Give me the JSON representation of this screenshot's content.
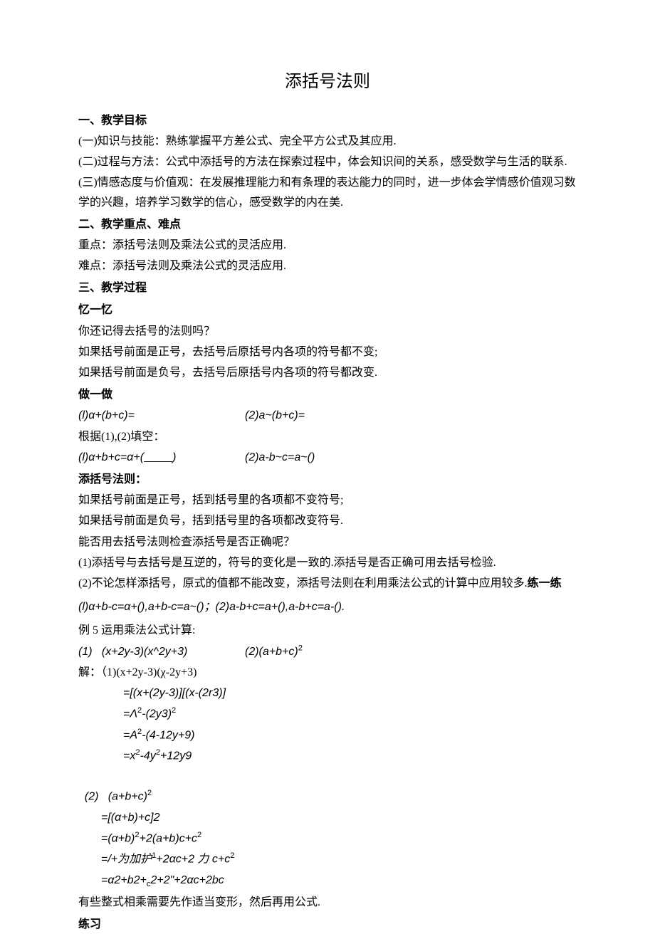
{
  "title": "添括号法则",
  "s1": {
    "heading": "一、教学目标",
    "p1": "(一)知识与技能：熟练掌握平方差公式、完全平方公式及其应用.",
    "p2": "(二)过程与方法：公式中添括号的方法在探索过程中，体会知识间的关系，感受数学与生活的联系.",
    "p3": "(三)情感态度与价值观：在发展推理能力和有条理的表达能力的同时，进一步体会学情感价值观习数学的兴趣，培养学习数学的信心，感受数学的内在美."
  },
  "s2": {
    "heading": "二、教学重点、难点",
    "p1": "重点：添括号法则及乘法公式的灵活应用.",
    "p2": "难点：添括号法则及乘法公式的灵活应用."
  },
  "s3": {
    "heading": "三、教学过程",
    "sub1": "忆一忆",
    "p1": "你还记得去括号的法则吗？",
    "p2": "如果括号前面是正号，去括号后原括号内各项的符号都不变;",
    "p3": "如果括号前面是负号，去括号后原括号内各项的符号都改变.",
    "sub2": "做一做",
    "eq1a": "(l)α+(b+c)=",
    "eq1b": "(2)a~(b+c)=",
    "p4": "根据(1),(2)填空：",
    "eq2a": "(l)α+b+c=α+(",
    "blank": "          ",
    "eq2a_end": ")",
    "eq2b": "(2)a-b~c=a~()",
    "sub3": "添括号法则：",
    "p5": "如果括号前面是正号，括到括号里的各项都不变符号;",
    "p6": "如果括号前面是负号，括到括号里的各项都改变符号.",
    "p7": "能否用去括号法则检查添括号是否正确呢？",
    "p8": "(1)添括号与去括号是互逆的，符号的变化是一致的.添括号是否正确可用去括号检验.",
    "p9_a": "(2)不论怎样添括号，原式的值都不能改变，添括号法则在利用乘法公式的计算中应用较多.",
    "p9_b": "练一练",
    "eq3": "(l)α+b-c=α+(),a+b-c=a~()；(2)a-b+c=a+(),a-b+c=a-().",
    "ex5": "例 5 运用乘法公式计算:",
    "ex5_1a": "(1)   (x+2y-3)(x^2y+3)",
    "ex5_1b": "(2)(a+b+c)",
    "sol": "解：（1)(x+2y-3)(χ-2y+3)",
    "sol_l1": "=[(x+(2y-3)][(x-(2r3)]",
    "sol_l2_a": "=Λ",
    "sol_l2_b": "-(2y3)",
    "sol_l3_a": "=A",
    "sol_l3_b": "-(4-12y+9)",
    "sol_l4_a": "=x",
    "sol_l4_b": "-4y",
    "sol_l4_c": "+12y9",
    "ex5_2": "(2)   (a+b+c)",
    "sol2_l1": "=[(α+b)+c]2",
    "sol2_l2_a": "=(α+b)",
    "sol2_l2_b": "+2(a+b)c+c",
    "sol2_l3_a": "=/+为加护",
    "sol2_l3_b": "+2αc+2 力 c+c",
    "sol2_l4": "=α2+b2+",
    "sol2_l4_sub": "c",
    "sol2_l4_b": "2+2\"+2αc+2bc",
    "p10": "有些整式相乘需要先作适当变形，然后再用公式.",
    "sub4": "练习"
  }
}
